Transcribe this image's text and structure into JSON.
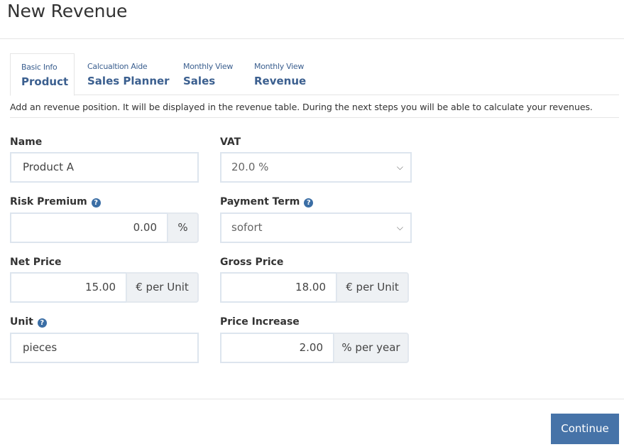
{
  "header": {
    "title": "New Revenue"
  },
  "tabs": [
    {
      "sub": "Basic Info",
      "main": "Product",
      "active": true
    },
    {
      "sub": "Calcualtion Aide",
      "main": "Sales Planner",
      "active": false
    },
    {
      "sub": "Monthly View",
      "main": "Sales",
      "active": false
    },
    {
      "sub": "Monthly View",
      "main": "Revenue",
      "active": false
    }
  ],
  "description": "Add an revenue position. It will be displayed in the revenue table. During the next steps you will be able to calculate your revenues.",
  "form": {
    "name": {
      "label": "Name",
      "value": "Product A"
    },
    "vat": {
      "label": "VAT",
      "value": "20.0 %"
    },
    "risk_premium": {
      "label": "Risk Premium",
      "value": "0.00",
      "addon": "%"
    },
    "payment_term": {
      "label": "Payment Term",
      "value": "sofort"
    },
    "net_price": {
      "label": "Net Price",
      "value": "15.00",
      "addon": "€ per Unit"
    },
    "gross_price": {
      "label": "Gross Price",
      "value": "18.00",
      "addon": "€ per Unit"
    },
    "unit": {
      "label": "Unit",
      "value": "pieces"
    },
    "price_increase": {
      "label": "Price Increase",
      "value": "2.00",
      "addon": "% per year"
    }
  },
  "icons": {
    "help": "?",
    "chevron": "⌵"
  },
  "footer": {
    "continue_label": "Continue"
  },
  "colors": {
    "accent": "#4673a8",
    "tab_text": "#3b5f8f",
    "help_icon": "#3b6ea5"
  }
}
